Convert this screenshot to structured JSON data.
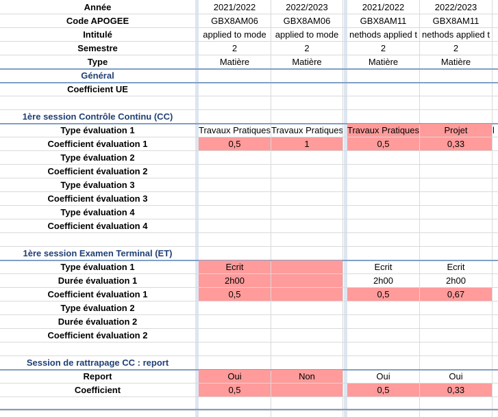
{
  "sheet": {
    "rows": [
      {
        "label": "Année",
        "kind": "header",
        "cells": [
          "2021/2022",
          "2022/2023",
          "2021/2022",
          "2022/2023",
          ""
        ],
        "hl": []
      },
      {
        "label": "Code APOGEE",
        "kind": "header",
        "cells": [
          "GBX8AM06",
          "GBX8AM06",
          "GBX8AM11",
          "GBX8AM11",
          ""
        ],
        "hl": []
      },
      {
        "label": "Intitulé",
        "kind": "header",
        "cells": [
          "applied to mode",
          "applied to mode",
          "nethods applied t",
          "nethods applied t",
          ""
        ],
        "hl": []
      },
      {
        "label": "Semestre",
        "kind": "header",
        "cells": [
          "2",
          "2",
          "2",
          "2",
          ""
        ],
        "hl": []
      },
      {
        "label": "Type",
        "kind": "header",
        "cells": [
          "Matière",
          "Matière",
          "Matière",
          "Matière",
          ""
        ],
        "hl": []
      },
      {
        "label": "Général",
        "kind": "section",
        "cells": [
          "",
          "",
          "",
          "",
          ""
        ],
        "hl": []
      },
      {
        "label": "Coefficient UE",
        "kind": "normal",
        "cells": [
          "",
          "",
          "",
          "",
          ""
        ],
        "hl": []
      },
      {
        "label": "",
        "kind": "blank",
        "cells": [
          "",
          "",
          "",
          "",
          ""
        ],
        "hl": []
      },
      {
        "label": "1ère session Contrôle Continu (CC)",
        "kind": "section",
        "cells": [
          "",
          "",
          "",
          "",
          ""
        ],
        "hl": []
      },
      {
        "label": "Type évaluation 1",
        "kind": "normal",
        "cells": [
          "Travaux Pratiques",
          "Travaux Pratiques",
          "Travaux Pratiques",
          "Projet",
          "l"
        ],
        "hl": [
          2,
          3
        ]
      },
      {
        "label": "Coefficient évaluation 1",
        "kind": "normal",
        "cells": [
          "0,5",
          "1",
          "0,5",
          "0,33",
          ""
        ],
        "hl": [
          0,
          1,
          2,
          3
        ]
      },
      {
        "label": "Type évaluation 2",
        "kind": "normal",
        "cells": [
          "",
          "",
          "",
          "",
          ""
        ],
        "hl": []
      },
      {
        "label": "Coefficient évaluation 2",
        "kind": "normal",
        "cells": [
          "",
          "",
          "",
          "",
          ""
        ],
        "hl": []
      },
      {
        "label": "Type évaluation 3",
        "kind": "normal",
        "cells": [
          "",
          "",
          "",
          "",
          ""
        ],
        "hl": []
      },
      {
        "label": "Coefficient évaluation 3",
        "kind": "normal",
        "cells": [
          "",
          "",
          "",
          "",
          ""
        ],
        "hl": []
      },
      {
        "label": "Type évaluation 4",
        "kind": "normal",
        "cells": [
          "",
          "",
          "",
          "",
          ""
        ],
        "hl": []
      },
      {
        "label": "Coefficient évaluation 4",
        "kind": "normal",
        "cells": [
          "",
          "",
          "",
          "",
          ""
        ],
        "hl": []
      },
      {
        "label": "",
        "kind": "blank",
        "cells": [
          "",
          "",
          "",
          "",
          ""
        ],
        "hl": []
      },
      {
        "label": "1ère session Examen Terminal (ET)",
        "kind": "section",
        "cells": [
          "",
          "",
          "",
          "",
          ""
        ],
        "hl": []
      },
      {
        "label": "Type évaluation 1",
        "kind": "normal",
        "cells": [
          "Ecrit",
          "",
          "Ecrit",
          "Ecrit",
          ""
        ],
        "hl": [
          0,
          1
        ]
      },
      {
        "label": "Durée évaluation 1",
        "kind": "normal",
        "cells": [
          "2h00",
          "",
          "2h00",
          "2h00",
          ""
        ],
        "hl": [
          0,
          1
        ]
      },
      {
        "label": "Coefficient évaluation 1",
        "kind": "normal",
        "cells": [
          "0,5",
          "",
          "0,5",
          "0,67",
          ""
        ],
        "hl": [
          0,
          1,
          2,
          3
        ]
      },
      {
        "label": "Type évaluation 2",
        "kind": "normal",
        "cells": [
          "",
          "",
          "",
          "",
          ""
        ],
        "hl": []
      },
      {
        "label": "Durée évaluation 2",
        "kind": "normal",
        "cells": [
          "",
          "",
          "",
          "",
          ""
        ],
        "hl": []
      },
      {
        "label": "Coefficient évaluation 2",
        "kind": "normal",
        "cells": [
          "",
          "",
          "",
          "",
          ""
        ],
        "hl": []
      },
      {
        "label": "",
        "kind": "blank",
        "cells": [
          "",
          "",
          "",
          "",
          ""
        ],
        "hl": []
      },
      {
        "label": "Session de rattrapage CC : report",
        "kind": "section",
        "cells": [
          "",
          "",
          "",
          "",
          ""
        ],
        "hl": []
      },
      {
        "label": "Report",
        "kind": "normal",
        "cells": [
          "Oui",
          "Non",
          "Oui",
          "Oui",
          ""
        ],
        "hl": [
          0,
          1
        ]
      },
      {
        "label": "Coefficient",
        "kind": "normal",
        "cells": [
          "0,5",
          "",
          "0,5",
          "0,33",
          ""
        ],
        "hl": [
          0,
          1,
          2,
          3
        ]
      },
      {
        "label": "",
        "kind": "blank",
        "cells": [
          "",
          "",
          "",
          "",
          ""
        ],
        "hl": []
      }
    ]
  },
  "colors": {
    "highlight": "#ff9b9b",
    "section_text": "#1f3f74",
    "section_border": "#7f9fc6",
    "column_separator": "#dce6f1",
    "grid": "#d9d9d9"
  }
}
